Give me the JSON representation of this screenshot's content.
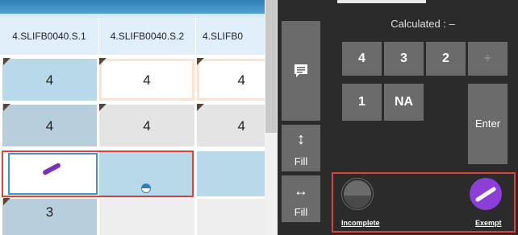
{
  "grid": {
    "headers": [
      "4.SLIFB0040.S.1",
      "4.SLIFB0040.S.2",
      "4.SLIFB0"
    ],
    "rows": [
      [
        "4",
        "4",
        "4"
      ],
      [
        "4",
        "4",
        "4"
      ],
      [
        "",
        "",
        ""
      ],
      [
        "3",
        "",
        ""
      ]
    ]
  },
  "panel": {
    "calculated": "Calculated : –",
    "comment_icon": "comment-icon",
    "fill_vertical_label": "Fill",
    "fill_horizontal_label": "Fill",
    "keys": {
      "k4": "4",
      "k3": "3",
      "k2": "2",
      "plus": "+",
      "k1": "1",
      "na": "NA",
      "enter": "Enter"
    },
    "incomplete_label": "Incomplete",
    "exempt_label": "Exempt"
  },
  "colors": {
    "selection_outline": "#d9433c",
    "exempt_purple": "#8b3fd6",
    "accent_blue": "#2f7fb5"
  }
}
